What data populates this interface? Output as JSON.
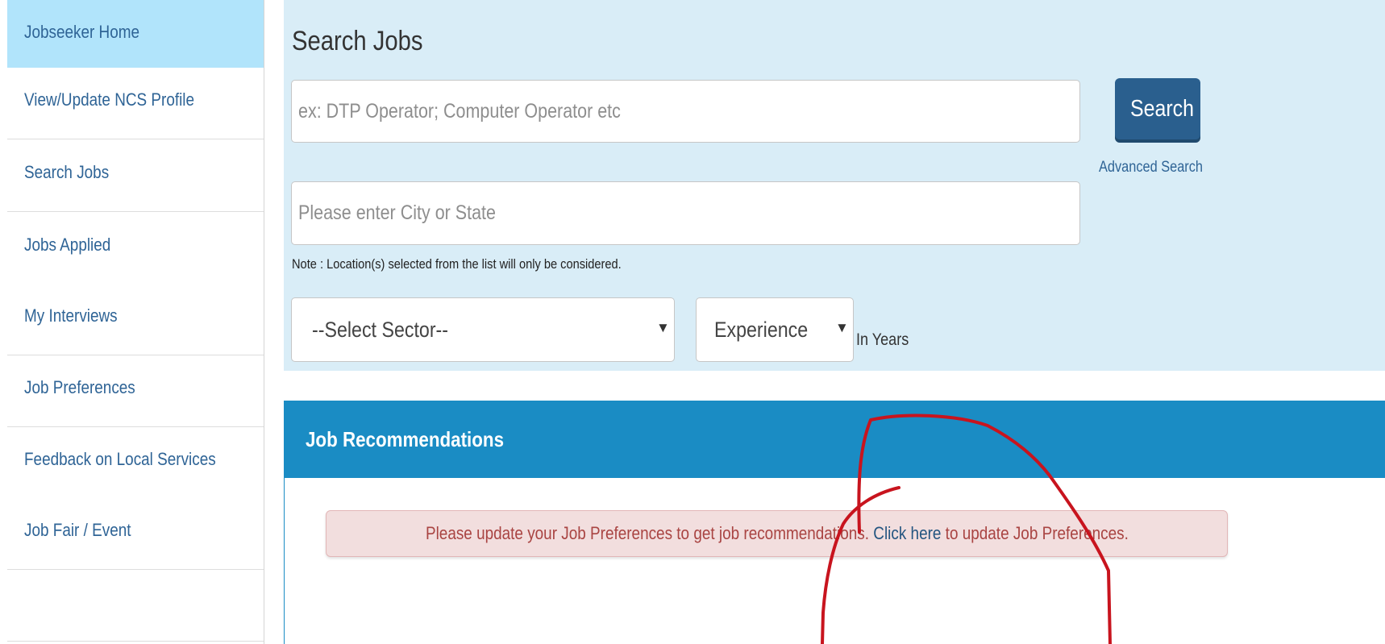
{
  "sidebar": {
    "items": [
      {
        "label": "Jobseeker Home",
        "active": true
      },
      {
        "label": "View/Update NCS Profile"
      },
      {
        "label": "Search Jobs"
      },
      {
        "label": "Jobs Applied"
      },
      {
        "label": "My Interviews"
      },
      {
        "label": "Job Preferences"
      },
      {
        "label": "Feedback on Local Services"
      },
      {
        "label": "Job Fair / Event"
      },
      {
        "label": ""
      }
    ]
  },
  "search": {
    "title": "Search Jobs",
    "keyword_placeholder": "ex: DTP Operator; Computer Operator etc",
    "location_placeholder": "Please enter City or State",
    "search_button": "Search",
    "advanced_link": "Advanced Search",
    "note": "Note : Location(s) selected from the list will only be considered.",
    "sector_select": "--Select Sector--",
    "experience_select": "Experience",
    "years_label": "In Years"
  },
  "recommendations": {
    "title": "Job Recommendations",
    "alert_before": "Please update your Job Preferences to get job recommendations.",
    "alert_link": "Click here",
    "alert_after": "to update Job Preferences."
  },
  "colors": {
    "sidebar_active_bg": "#b1e4fb",
    "sidebar_link": "#2f6496",
    "search_panel_bg": "#d9edf7",
    "search_button_bg": "#2a5f8e",
    "rec_header_bg": "#1a8cc4",
    "alert_bg": "#f2dede",
    "alert_text": "#a94442",
    "annotation_stroke": "#c8141e"
  }
}
